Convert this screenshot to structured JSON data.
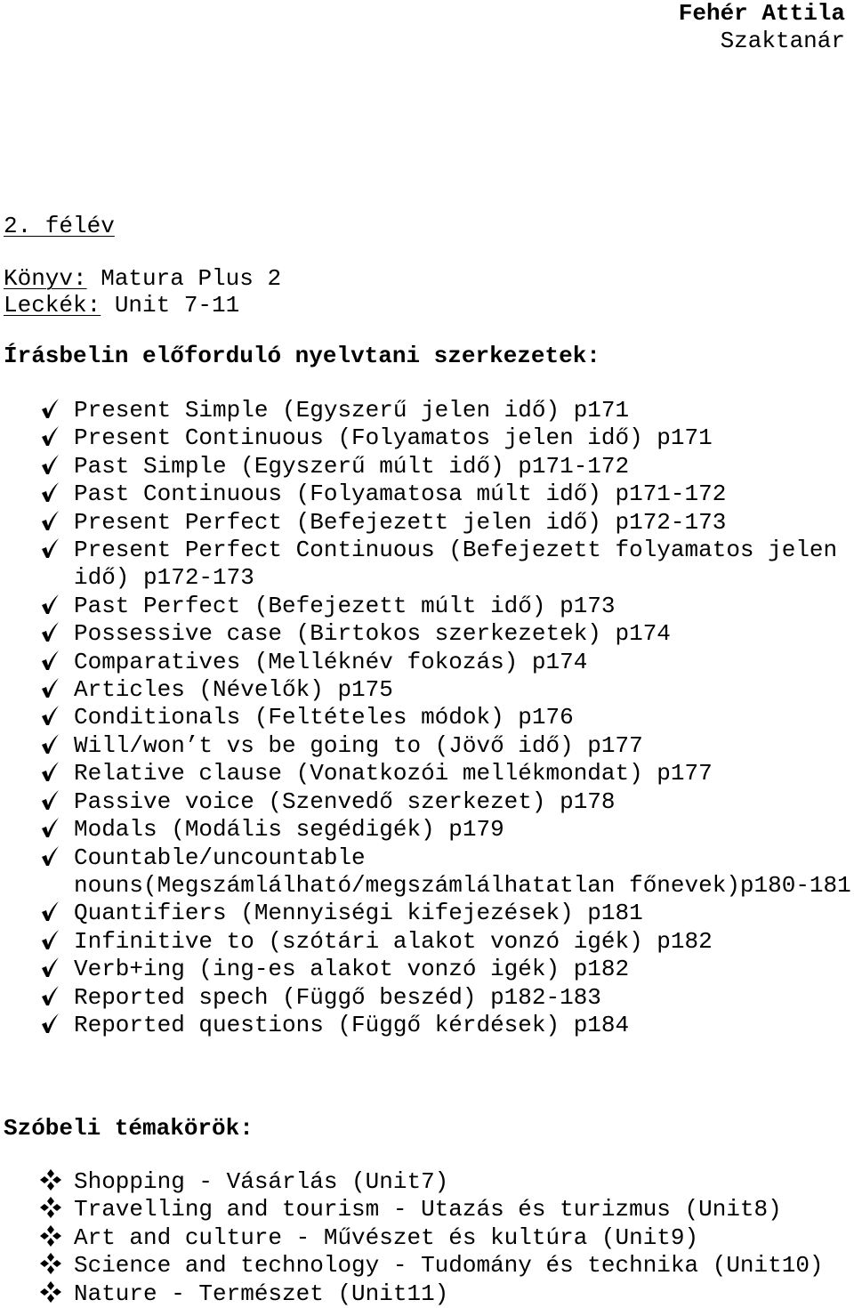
{
  "header": {
    "name": "Fehér Attila",
    "role": "Szaktanár"
  },
  "semester": "2. félév",
  "book": {
    "label": "Könyv:",
    "value": " Matura Plus 2"
  },
  "lessons": {
    "label": "Leckék:",
    "value": " Unit 7-11"
  },
  "written_section": {
    "title": "Írásbelin előforduló nyelvtani szerkezetek:",
    "bullet_icon": "check-mark-icon",
    "items": [
      "Present Simple (Egyszerű jelen idő) p171",
      "Present Continuous (Folyamatos jelen idő) p171",
      "Past Simple (Egyszerű múlt idő) p171-172",
      "Past Continuous (Folyamatosa múlt idő) p171-172",
      "Present Perfect (Befejezett jelen idő) p172-173",
      "Present Perfect Continuous (Befejezett folyamatos jelen\nidő) p172-173",
      "Past Perfect (Befejezett múlt idő) p173",
      "Possessive case (Birtokos szerkezetek) p174",
      "Comparatives (Melléknév fokozás) p174",
      "Articles (Névelők) p175",
      "Conditionals (Feltételes módok) p176",
      "Will/won’t vs be going to (Jövő idő) p177",
      "Relative clause (Vonatkozói mellékmondat) p177",
      "Passive voice (Szenvedő szerkezet) p178",
      "Modals (Modális segédigék) p179",
      "Countable/uncountable\nnouns(Megszámlálható/megszámlálhatatlan főnevek)p180-181",
      "Quantifiers (Mennyiségi kifejezések) p181",
      "Infinitive to (szótári alakot vonzó igék) p182",
      "Verb+ing (ing-es alakot vonzó igék) p182",
      "Reported spech (Függő beszéd) p182-183",
      "Reported questions (Függő kérdések) p184"
    ]
  },
  "oral_section": {
    "title": "Szóbeli témakörök:",
    "bullet_icon": "four-diamond-bullet-icon",
    "items": [
      "Shopping - Vásárlás (Unit7)",
      "Travelling and tourism - Utazás és turizmus (Unit8)",
      "Art and culture - Művészet és kultúra (Unit9)",
      "Science and technology - Tudomány és technika (Unit10)",
      "Nature - Természet (Unit11)"
    ]
  }
}
